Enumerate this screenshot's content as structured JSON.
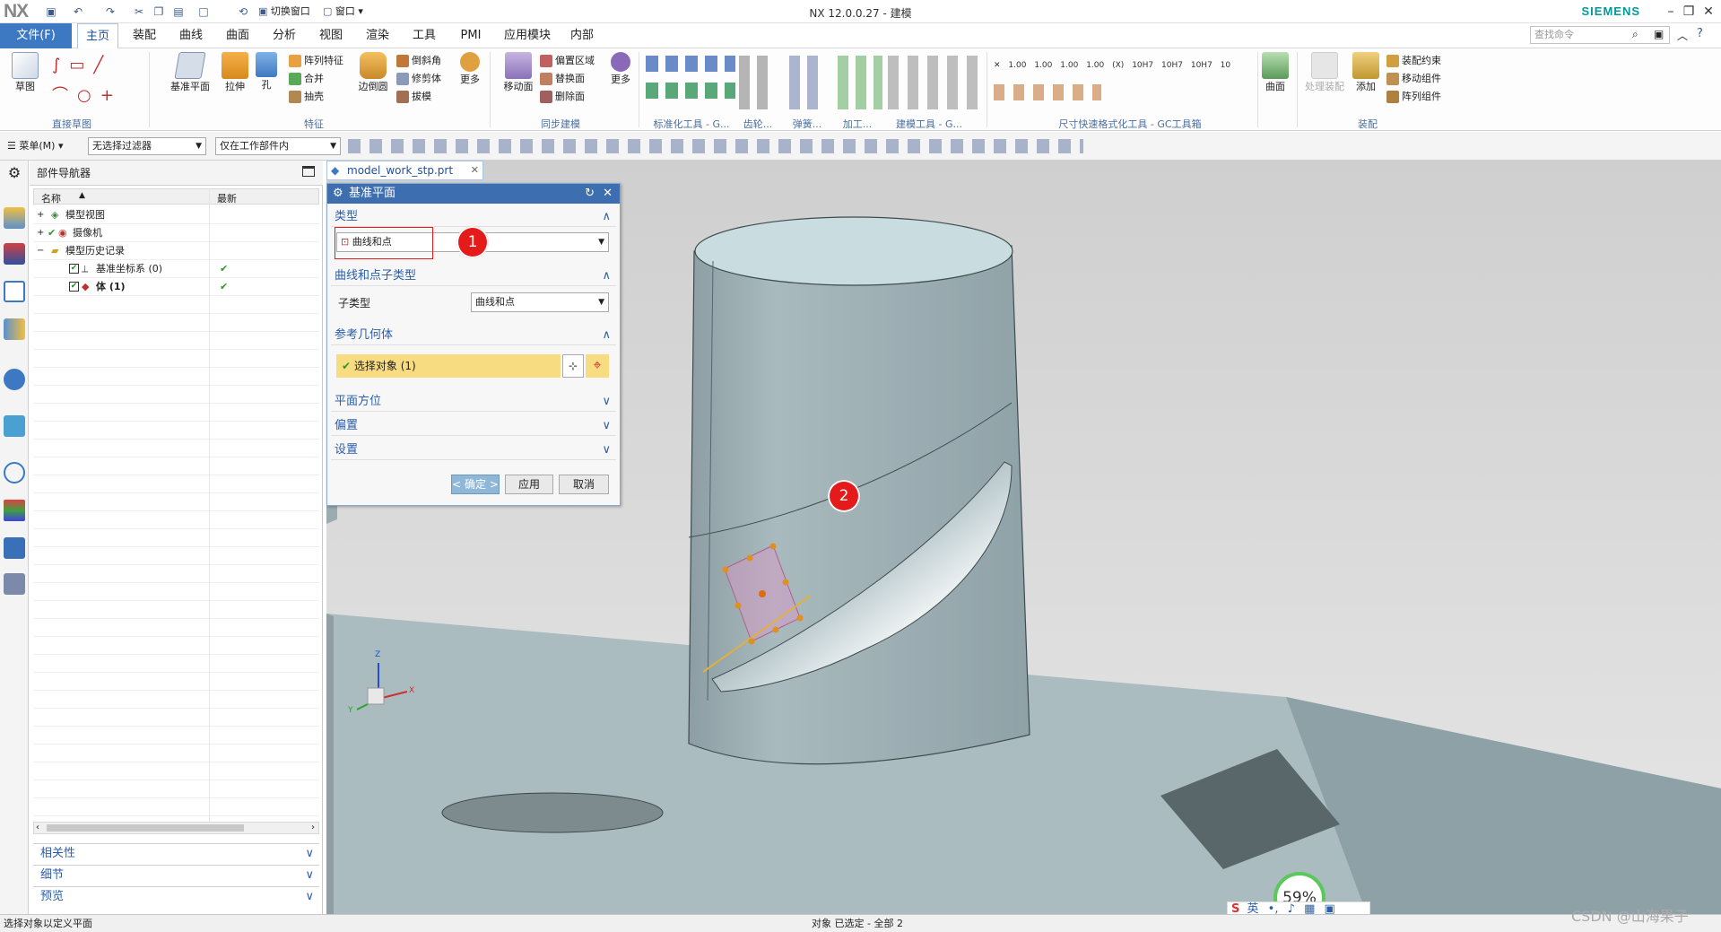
{
  "app": {
    "logo": "NX",
    "title": "NX 12.0.0.27 - 建模",
    "brand": "SIEMENS",
    "quick_switch_window": "切换窗口",
    "quick_window": "窗口"
  },
  "ribbon": {
    "file_tab": "文件(F)",
    "tabs": [
      "主页",
      "装配",
      "曲线",
      "曲面",
      "分析",
      "视图",
      "渲染",
      "工具",
      "PMI",
      "应用模块",
      "内部"
    ],
    "active_tab": "主页",
    "search_placeholder": "查找命令",
    "buttons": {
      "sketch": "草图",
      "datum_plane": "基准平面",
      "extrude": "拉伸",
      "hole": "孔",
      "pattern_feature": "阵列特征",
      "unite": "合并",
      "shell": "抽壳",
      "edge_blend": "边倒圆",
      "chamfer": "倒斜角",
      "trim_body": "修剪体",
      "draft": "拔模",
      "more1": "更多",
      "move_face": "移动面",
      "offset_region": "偏置区域",
      "replace_face": "替换面",
      "delete_face": "删除面",
      "more2": "更多",
      "surface": "曲面",
      "process_assembly": "处理装配",
      "add": "添加",
      "assembly_constraints": "装配约束",
      "move_component": "移动组件",
      "pattern_component": "阵列组件"
    },
    "groups": {
      "direct_sketch": "直接草图",
      "feature": "特征",
      "sync_modeling": "同步建模",
      "standard_tools": "标准化工具 - G...",
      "gear": "齿轮...",
      "spring": "弹簧...",
      "machining": "加工...",
      "modeling_tools": "建模工具 - G...",
      "dimension_tools": "尺寸快速格式化工具 - GC工具箱",
      "assembly": "装配"
    },
    "dim_labels": [
      "1.00",
      "1.00",
      "1.00",
      "1.00",
      "(X)",
      "10H7",
      "10H7",
      "10H7",
      "10"
    ]
  },
  "selection_bar": {
    "menu": "菜单(M)",
    "filter": "无选择过滤器",
    "scope": "仅在工作部件内"
  },
  "navigator": {
    "title": "部件导航器",
    "col_name": "名称",
    "col_latest": "最新",
    "tree": [
      {
        "label": "模型视图",
        "latest": ""
      },
      {
        "label": "摄像机",
        "latest": ""
      },
      {
        "label": "模型历史记录",
        "latest": ""
      },
      {
        "label": "基准坐标系 (0)",
        "latest": "✔"
      },
      {
        "label": "体 (1)",
        "latest": "✔"
      }
    ],
    "panels": [
      "相关性",
      "细节",
      "预览"
    ]
  },
  "document": {
    "tab": "model_work_stp.prt"
  },
  "dialog": {
    "title": "基准平面",
    "sections": {
      "type": "类型",
      "curve_point_subtype": "曲线和点子类型",
      "ref_geometry": "参考几何体",
      "plane_orientation": "平面方位",
      "offset": "偏置",
      "settings": "设置"
    },
    "type_value": "曲线和点",
    "subtype_label": "子类型",
    "subtype_value": "曲线和点",
    "select_object": "选择对象 (1)",
    "ok": "< 确定 >",
    "apply": "应用",
    "cancel": "取消"
  },
  "annotations": {
    "marker1": "1",
    "marker2": "2"
  },
  "viewport": {
    "zoom_badge": "59%"
  },
  "status": {
    "left": "选择对象以定义平面",
    "center": "对象 已选定 - 全部 2",
    "watermark": "CSDN @山海果子",
    "ime": "英"
  },
  "colors": {
    "accent": "#3c79c2",
    "model": "#a9babe",
    "marker": "#e51b1b",
    "highlight": "#f8dc82"
  }
}
